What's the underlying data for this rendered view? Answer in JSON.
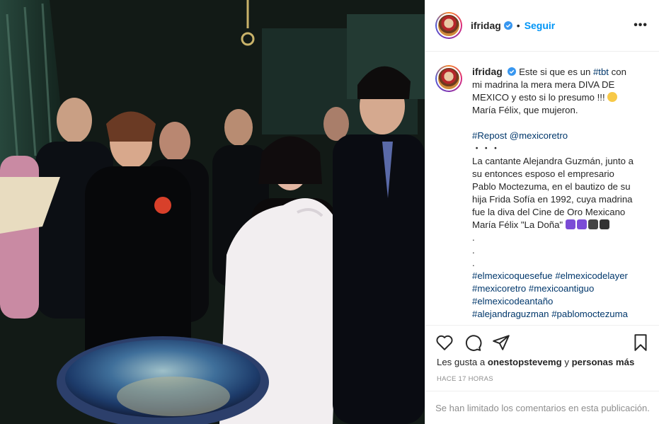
{
  "post": {
    "photo_alt": "",
    "author": "ifridag",
    "verified": true,
    "follow_label": "Seguir",
    "separator": "•",
    "more_label": "•••"
  },
  "caption": {
    "author": "ifridag",
    "p1_lines": [
      "Este si que es un",
      "#tbt",
      "con",
      "mi madrina la mera mera DIVA DE",
      "MEXICO y esto si lo presumo !!!",
      "María Félix, que mujeron."
    ],
    "repost_tag": "#Repost",
    "repost_user": "@mexicoretro",
    "dots": "・・・",
    "p2_lines": [
      "La cantante Alejandra Guzmán, junto a",
      "su entonces esposo el empresario",
      "Pablo Moctezuma, en el bautizo de su",
      "hija Frida Sofía en 1992, cuya madrina",
      "fue la diva del Cine de Oro Mexicano",
      "María Félix \"La Doña\""
    ],
    "periods": [
      ".",
      ".",
      "."
    ],
    "hashtags_lines": [
      [
        "#elmexicoquesefue",
        "#elmexicodelayer"
      ],
      [
        "#mexicoretro",
        "#mexicoantiguo"
      ],
      [
        "#elmexicodeantaño"
      ],
      [
        "#alejandraguzman",
        "#pablomoctezuma"
      ]
    ]
  },
  "likes": {
    "prefix": "Les gusta a",
    "user": "onestopstevemg",
    "middle": "y",
    "others": "personas más"
  },
  "timestamp": "HACE 17 HORAS",
  "comments_disabled": "Se han limitado los comentarios en esta publicación.",
  "colors": {
    "link": "#00376b",
    "follow": "#0095f6",
    "muted": "#8e8e8e",
    "verified": "#3897f0"
  },
  "icons": [
    "heart-icon",
    "comment-icon",
    "share-icon",
    "bookmark-icon",
    "verified-icon",
    "more-icon"
  ]
}
